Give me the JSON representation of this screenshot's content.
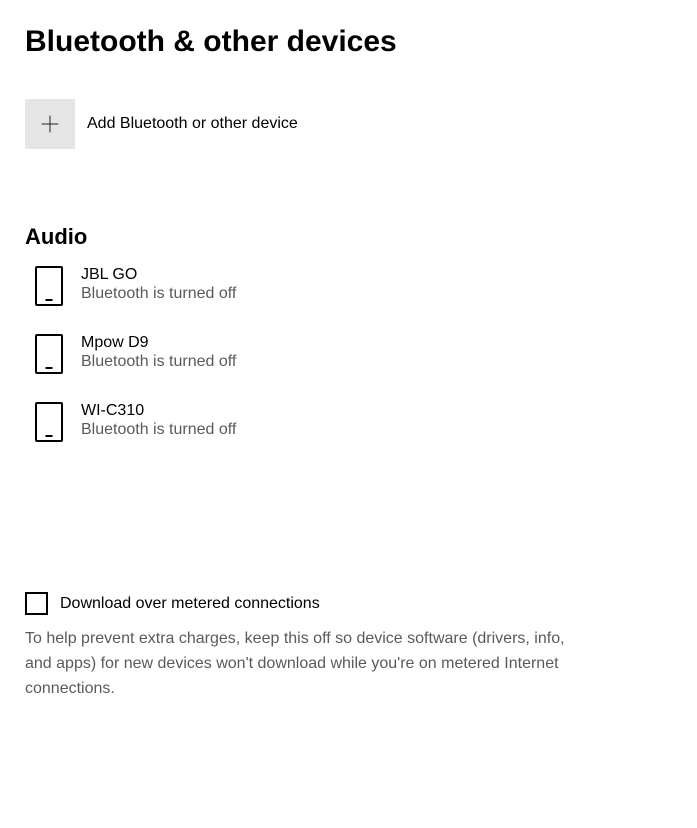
{
  "page_title": "Bluetooth & other devices",
  "add_device_label": "Add Bluetooth or other device",
  "audio_section": {
    "heading": "Audio",
    "devices": [
      {
        "name": "JBL GO",
        "status": "Bluetooth is turned off"
      },
      {
        "name": "Mpow D9",
        "status": "Bluetooth is turned off"
      },
      {
        "name": "WI-C310",
        "status": "Bluetooth is turned off"
      }
    ]
  },
  "metered": {
    "label": "Download over metered connections",
    "checked": false,
    "description": "To help prevent extra charges, keep this off so device software (drivers, info, and apps) for new devices won't download while you're on metered Internet connections."
  }
}
